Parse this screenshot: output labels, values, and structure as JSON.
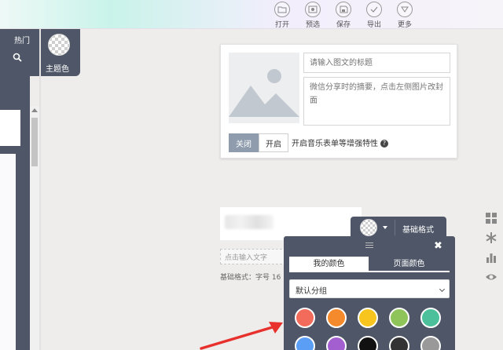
{
  "toolbar": {
    "items": [
      {
        "label": "打开",
        "icon": "folder-open-icon"
      },
      {
        "label": "预选",
        "icon": "preview-icon"
      },
      {
        "label": "保存",
        "icon": "save-icon"
      },
      {
        "label": "导出",
        "icon": "export-icon"
      },
      {
        "label": "更多",
        "icon": "more-icon"
      }
    ]
  },
  "left_panel": {
    "hot_label": "热门",
    "theme_label": "主题色"
  },
  "card": {
    "title_placeholder": "请输入图文的标题",
    "summary_placeholder": "微信分享时的摘要，点击左侧图片改封面",
    "toggle_off_label": "关闭",
    "toggle_on_label": "开启",
    "music_label": "开启音乐表单等增强特性",
    "help_symbol": "?"
  },
  "editor": {
    "click_input_text": "点击输入文字",
    "format_info": "基础格式：字号 16"
  },
  "format_bar": {
    "label": "基础格式"
  },
  "color_picker": {
    "close_symbol": "✖",
    "tabs": [
      {
        "label": "我的颜色",
        "active": true
      },
      {
        "label": "页面颜色",
        "active": false
      }
    ],
    "group_selected": "默认分组",
    "swatches": [
      {
        "color": "#f26b5b"
      },
      {
        "color": "#f58a2c"
      },
      {
        "color": "#f7c51d"
      },
      {
        "color": "#8fc45a"
      },
      {
        "color": "#4cc09a"
      },
      {
        "color": "#5b9ef5"
      },
      {
        "color": "#a35fd0"
      },
      {
        "color": "#111111"
      },
      {
        "color": "#333333"
      },
      {
        "color": "#999999"
      }
    ]
  },
  "colors": {
    "dark_panel": "#4e5667",
    "accent_off": "#8e9cad",
    "arrow": "#e8312d"
  }
}
